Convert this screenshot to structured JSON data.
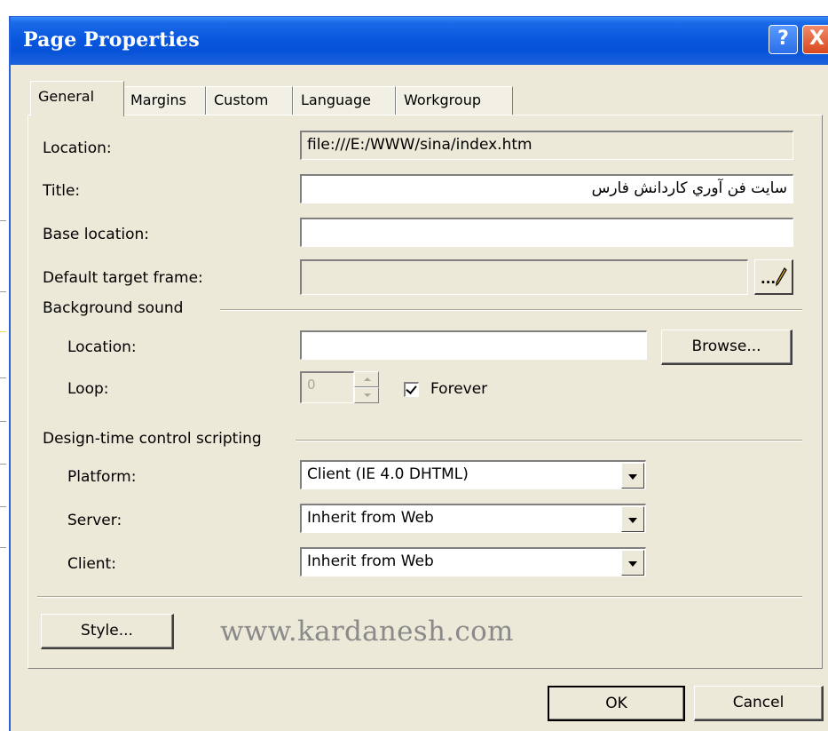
{
  "window": {
    "title": "Page Properties",
    "help_label": "?",
    "close_label": "X"
  },
  "tabs": [
    "General",
    "Margins",
    "Custom",
    "Language",
    "Workgroup"
  ],
  "general": {
    "location_label": "Location:",
    "location_value": "file:///E:/WWW/sina/index.htm",
    "title_label": "Title:",
    "title_value": "سايت فن آوري كاردانش فارس",
    "base_location_label": "Base location:",
    "base_location_value": "",
    "default_target_label": "Default target frame:",
    "default_target_value": "",
    "ellipsis_button": "..."
  },
  "background_sound": {
    "group_label": "Background sound",
    "location_label": "Location:",
    "location_value": "",
    "browse_button": "Browse...",
    "loop_label": "Loop:",
    "loop_value": "0",
    "forever_label": "Forever",
    "forever_checked": true
  },
  "scripting": {
    "group_label": "Design-time control scripting",
    "platform_label": "Platform:",
    "platform_value": "Client (IE 4.0 DHTML)",
    "server_label": "Server:",
    "server_value": "Inherit from Web",
    "client_label": "Client:",
    "client_value": "Inherit from Web"
  },
  "style_button": "Style...",
  "watermark": "www.kardanesh.com",
  "ok_button": "OK",
  "cancel_button": "Cancel",
  "colors": {
    "titlebar": "#0652d8",
    "dialog_bg": "#ece9d8",
    "watermark": "#8a8a8a"
  }
}
